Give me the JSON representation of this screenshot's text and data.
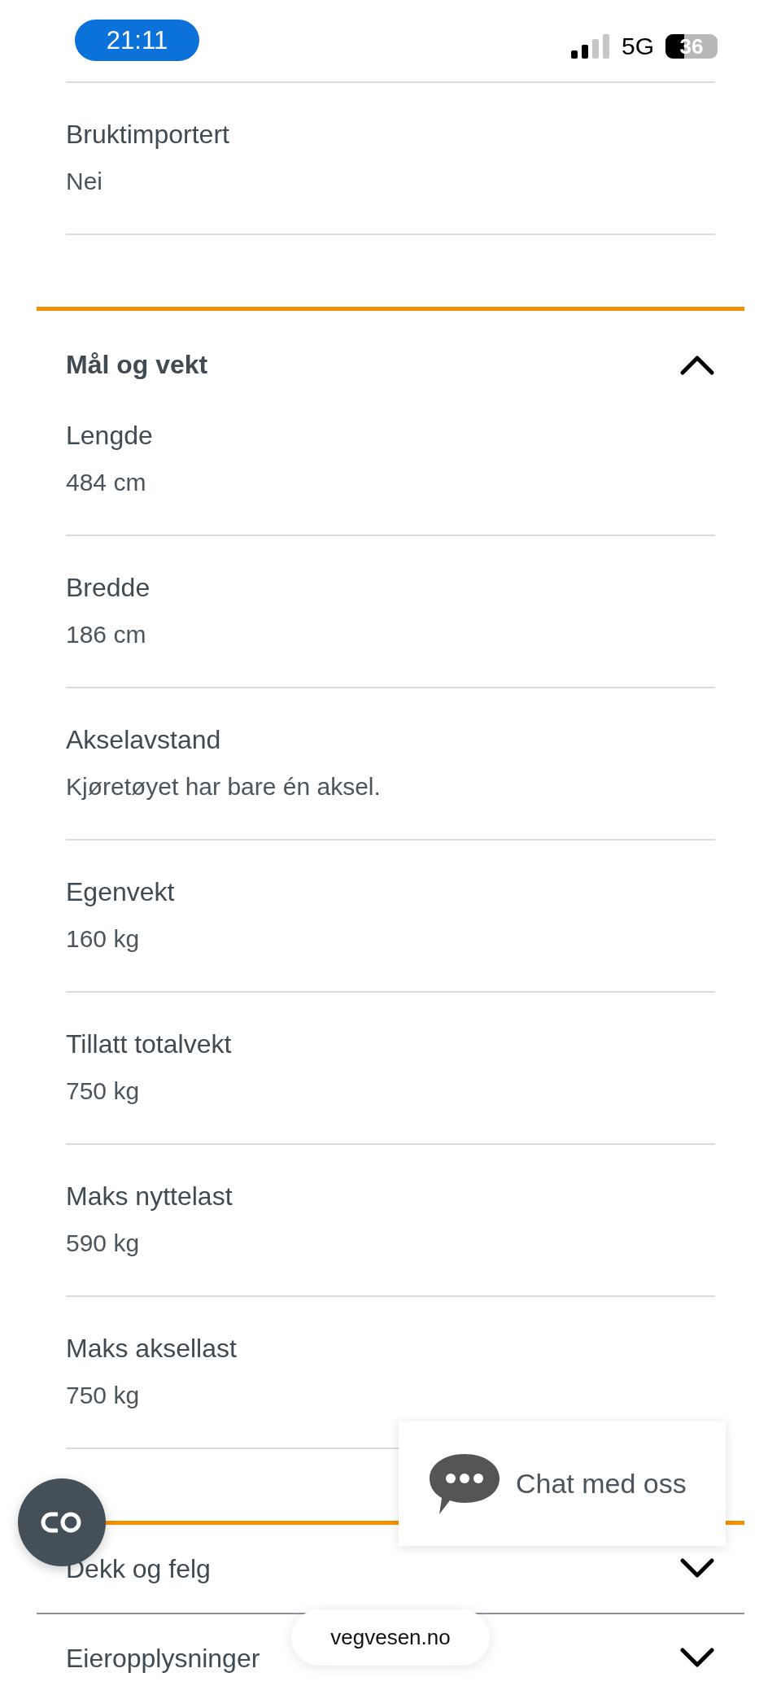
{
  "status_bar": {
    "time": "21:11",
    "network": "5G",
    "battery": "36"
  },
  "top_rows": [
    {
      "label": "Bruktimportert",
      "value": "Nei"
    }
  ],
  "sections": [
    {
      "title": "Mål og vekt",
      "expanded": true,
      "rows": [
        {
          "label": "Lengde",
          "value": "484 cm"
        },
        {
          "label": "Bredde",
          "value": "186 cm"
        },
        {
          "label": "Akselavstand",
          "value": "Kjøretøyet har bare én aksel."
        },
        {
          "label": "Egenvekt",
          "value": "160 kg"
        },
        {
          "label": "Tillatt totalvekt",
          "value": "750 kg"
        },
        {
          "label": "Maks nyttelast",
          "value": "590 kg"
        },
        {
          "label": "Maks aksellast",
          "value": "750 kg"
        }
      ]
    },
    {
      "title": "Dekk og felg",
      "expanded": false
    },
    {
      "title": "Eieropplysninger",
      "expanded": false
    }
  ],
  "chat": {
    "label": "Chat med oss"
  },
  "url": "vegvesen.no"
}
